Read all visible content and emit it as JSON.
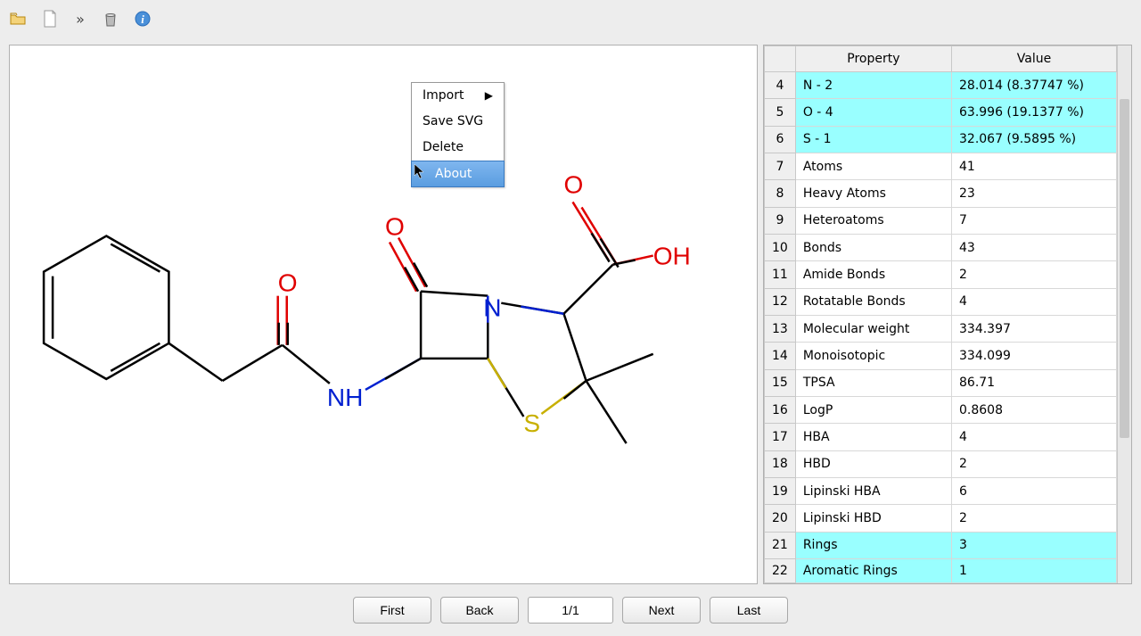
{
  "toolbar": {
    "icons": [
      "open-file-icon",
      "document-icon",
      "overflow-icon",
      "delete-icon",
      "info-icon"
    ]
  },
  "context_menu": {
    "items": [
      {
        "label": "Import",
        "has_submenu": true
      },
      {
        "label": "Save SVG",
        "has_submenu": false
      },
      {
        "label": "Delete",
        "has_submenu": false
      },
      {
        "label": "About",
        "has_submenu": false,
        "highlighted": true
      }
    ]
  },
  "molecule": {
    "atom_labels": [
      {
        "text": "O",
        "color": "#e00000"
      },
      {
        "text": "NH",
        "color": "#0020d0"
      },
      {
        "text": "O",
        "color": "#e00000"
      },
      {
        "text": "N",
        "color": "#0020d0"
      },
      {
        "text": "S",
        "color": "#c8b000"
      },
      {
        "text": "O",
        "color": "#e00000"
      },
      {
        "text": "OH",
        "color": "#e00000"
      }
    ]
  },
  "table": {
    "headers": {
      "rownum": "",
      "property": "Property",
      "value": "Value"
    },
    "rows": [
      {
        "n": "4",
        "property": "N - 2",
        "value": "28.014 (8.37747 %)",
        "hl": true
      },
      {
        "n": "5",
        "property": "O - 4",
        "value": "63.996 (19.1377 %)",
        "hl": true
      },
      {
        "n": "6",
        "property": "S - 1",
        "value": "32.067 (9.5895 %)",
        "hl": true
      },
      {
        "n": "7",
        "property": "Atoms",
        "value": "41"
      },
      {
        "n": "8",
        "property": "Heavy Atoms",
        "value": "23"
      },
      {
        "n": "9",
        "property": "Heteroatoms",
        "value": "7"
      },
      {
        "n": "10",
        "property": "Bonds",
        "value": "43"
      },
      {
        "n": "11",
        "property": "Amide Bonds",
        "value": "2"
      },
      {
        "n": "12",
        "property": "Rotatable Bonds",
        "value": "4"
      },
      {
        "n": "13",
        "property": "Molecular weight",
        "value": "334.397"
      },
      {
        "n": "14",
        "property": "Monoisotopic",
        "value": "334.099"
      },
      {
        "n": "15",
        "property": "TPSA",
        "value": "86.71"
      },
      {
        "n": "16",
        "property": "LogP",
        "value": "0.8608"
      },
      {
        "n": "17",
        "property": "HBA",
        "value": "4"
      },
      {
        "n": "18",
        "property": "HBD",
        "value": "2"
      },
      {
        "n": "19",
        "property": "Lipinski HBA",
        "value": "6"
      },
      {
        "n": "20",
        "property": "Lipinski HBD",
        "value": "2"
      },
      {
        "n": "21",
        "property": "Rings",
        "value": "3",
        "hl": true
      },
      {
        "n": "22",
        "property": "Aromatic Rings",
        "value": "1",
        "hl": true,
        "cut": true
      }
    ]
  },
  "nav": {
    "first": "First",
    "back": "Back",
    "page": "1/1",
    "next": "Next",
    "last": "Last"
  }
}
